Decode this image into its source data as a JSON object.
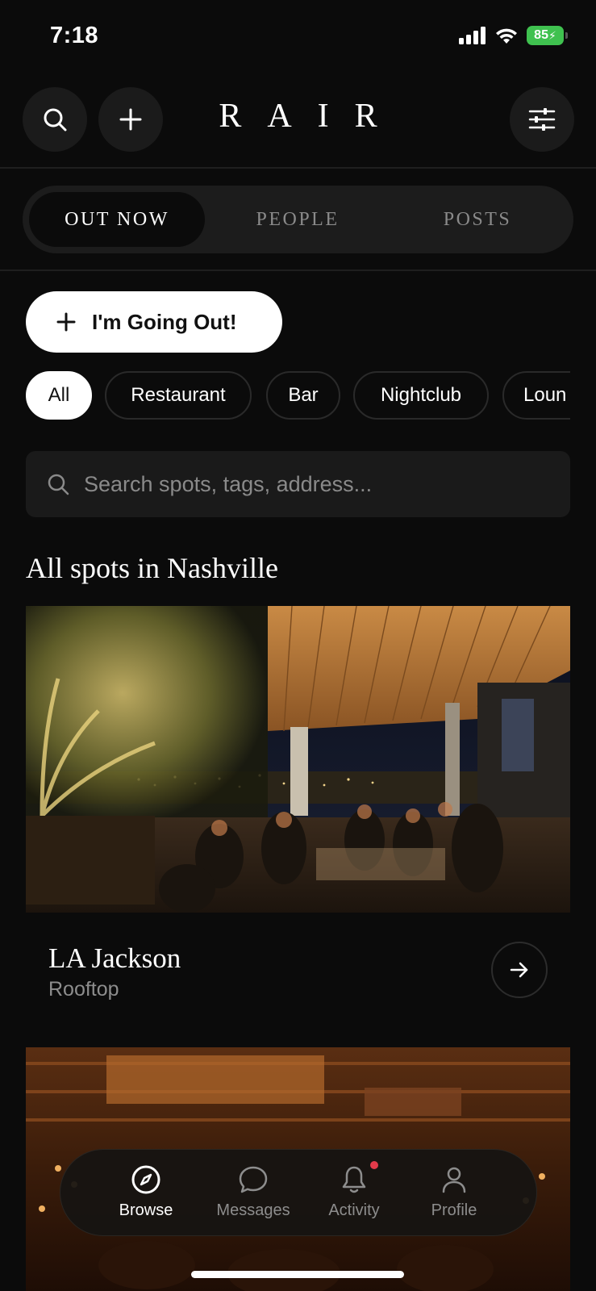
{
  "status_bar": {
    "time": "7:18",
    "battery": "85"
  },
  "header": {
    "logo": "RAIR"
  },
  "tabs": [
    {
      "label": "OUT NOW",
      "active": true
    },
    {
      "label": "PEOPLE",
      "active": false
    },
    {
      "label": "POSTS",
      "active": false
    }
  ],
  "going_out": {
    "label": "I'm Going Out!"
  },
  "filters": [
    {
      "label": "All",
      "active": true
    },
    {
      "label": "Restaurant"
    },
    {
      "label": "Bar"
    },
    {
      "label": "Nightclub"
    },
    {
      "label": "Loun"
    }
  ],
  "search": {
    "placeholder": "Search spots, tags, address..."
  },
  "section_title": "All spots in Nashville",
  "spots": [
    {
      "name": "LA Jackson",
      "type": "Rooftop"
    }
  ],
  "bottom_nav": [
    {
      "label": "Browse",
      "icon": "compass-icon",
      "active": true
    },
    {
      "label": "Messages",
      "icon": "chat-bubble-icon"
    },
    {
      "label": "Activity",
      "icon": "bell-icon",
      "notification": true
    },
    {
      "label": "Profile",
      "icon": "person-icon"
    }
  ],
  "colors": {
    "background": "#0b0b0b",
    "accent": "#ffffff",
    "battery": "#3fc14f",
    "notification": "#e23a4a"
  }
}
